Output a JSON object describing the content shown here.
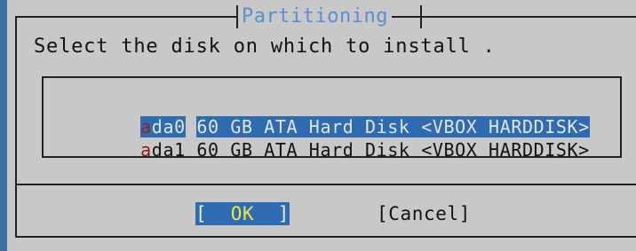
{
  "dialog": {
    "title": "Partitioning",
    "prompt": "Select the disk on which to install ."
  },
  "disks": [
    {
      "key": "a",
      "rest": "da0",
      "description": "60 GB ATA Hard Disk <VBOX HARDDISK>",
      "selected": true
    },
    {
      "key": "a",
      "rest": "da1",
      "description": "60 GB ATA Hard Disk <VBOX HARDDISK>",
      "selected": false
    }
  ],
  "buttons": {
    "ok_open": "[",
    "ok_label": "OK",
    "ok_close": "]",
    "cancel_label": "[Cancel]"
  },
  "colors": {
    "background": "#3b6fa3",
    "dialog": "#c8c8c8",
    "title": "#5a8fd0",
    "selection": "#2f6bb0",
    "hotkey": "#8a1a1a",
    "ok_text": "#f3e34a"
  }
}
